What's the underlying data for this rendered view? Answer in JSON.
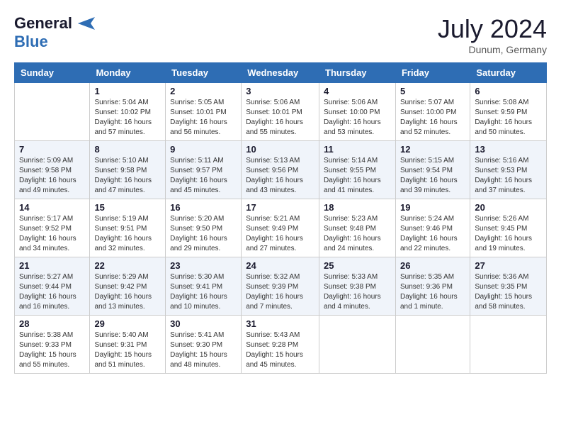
{
  "header": {
    "logo_general": "General",
    "logo_blue": "Blue",
    "month_year": "July 2024",
    "location": "Dunum, Germany"
  },
  "weekdays": [
    "Sunday",
    "Monday",
    "Tuesday",
    "Wednesday",
    "Thursday",
    "Friday",
    "Saturday"
  ],
  "weeks": [
    [
      {
        "day": "",
        "sunrise": "",
        "sunset": "",
        "daylight": ""
      },
      {
        "day": "1",
        "sunrise": "Sunrise: 5:04 AM",
        "sunset": "Sunset: 10:02 PM",
        "daylight": "Daylight: 16 hours and 57 minutes."
      },
      {
        "day": "2",
        "sunrise": "Sunrise: 5:05 AM",
        "sunset": "Sunset: 10:01 PM",
        "daylight": "Daylight: 16 hours and 56 minutes."
      },
      {
        "day": "3",
        "sunrise": "Sunrise: 5:06 AM",
        "sunset": "Sunset: 10:01 PM",
        "daylight": "Daylight: 16 hours and 55 minutes."
      },
      {
        "day": "4",
        "sunrise": "Sunrise: 5:06 AM",
        "sunset": "Sunset: 10:00 PM",
        "daylight": "Daylight: 16 hours and 53 minutes."
      },
      {
        "day": "5",
        "sunrise": "Sunrise: 5:07 AM",
        "sunset": "Sunset: 10:00 PM",
        "daylight": "Daylight: 16 hours and 52 minutes."
      },
      {
        "day": "6",
        "sunrise": "Sunrise: 5:08 AM",
        "sunset": "Sunset: 9:59 PM",
        "daylight": "Daylight: 16 hours and 50 minutes."
      }
    ],
    [
      {
        "day": "7",
        "sunrise": "Sunrise: 5:09 AM",
        "sunset": "Sunset: 9:58 PM",
        "daylight": "Daylight: 16 hours and 49 minutes."
      },
      {
        "day": "8",
        "sunrise": "Sunrise: 5:10 AM",
        "sunset": "Sunset: 9:58 PM",
        "daylight": "Daylight: 16 hours and 47 minutes."
      },
      {
        "day": "9",
        "sunrise": "Sunrise: 5:11 AM",
        "sunset": "Sunset: 9:57 PM",
        "daylight": "Daylight: 16 hours and 45 minutes."
      },
      {
        "day": "10",
        "sunrise": "Sunrise: 5:13 AM",
        "sunset": "Sunset: 9:56 PM",
        "daylight": "Daylight: 16 hours and 43 minutes."
      },
      {
        "day": "11",
        "sunrise": "Sunrise: 5:14 AM",
        "sunset": "Sunset: 9:55 PM",
        "daylight": "Daylight: 16 hours and 41 minutes."
      },
      {
        "day": "12",
        "sunrise": "Sunrise: 5:15 AM",
        "sunset": "Sunset: 9:54 PM",
        "daylight": "Daylight: 16 hours and 39 minutes."
      },
      {
        "day": "13",
        "sunrise": "Sunrise: 5:16 AM",
        "sunset": "Sunset: 9:53 PM",
        "daylight": "Daylight: 16 hours and 37 minutes."
      }
    ],
    [
      {
        "day": "14",
        "sunrise": "Sunrise: 5:17 AM",
        "sunset": "Sunset: 9:52 PM",
        "daylight": "Daylight: 16 hours and 34 minutes."
      },
      {
        "day": "15",
        "sunrise": "Sunrise: 5:19 AM",
        "sunset": "Sunset: 9:51 PM",
        "daylight": "Daylight: 16 hours and 32 minutes."
      },
      {
        "day": "16",
        "sunrise": "Sunrise: 5:20 AM",
        "sunset": "Sunset: 9:50 PM",
        "daylight": "Daylight: 16 hours and 29 minutes."
      },
      {
        "day": "17",
        "sunrise": "Sunrise: 5:21 AM",
        "sunset": "Sunset: 9:49 PM",
        "daylight": "Daylight: 16 hours and 27 minutes."
      },
      {
        "day": "18",
        "sunrise": "Sunrise: 5:23 AM",
        "sunset": "Sunset: 9:48 PM",
        "daylight": "Daylight: 16 hours and 24 minutes."
      },
      {
        "day": "19",
        "sunrise": "Sunrise: 5:24 AM",
        "sunset": "Sunset: 9:46 PM",
        "daylight": "Daylight: 16 hours and 22 minutes."
      },
      {
        "day": "20",
        "sunrise": "Sunrise: 5:26 AM",
        "sunset": "Sunset: 9:45 PM",
        "daylight": "Daylight: 16 hours and 19 minutes."
      }
    ],
    [
      {
        "day": "21",
        "sunrise": "Sunrise: 5:27 AM",
        "sunset": "Sunset: 9:44 PM",
        "daylight": "Daylight: 16 hours and 16 minutes."
      },
      {
        "day": "22",
        "sunrise": "Sunrise: 5:29 AM",
        "sunset": "Sunset: 9:42 PM",
        "daylight": "Daylight: 16 hours and 13 minutes."
      },
      {
        "day": "23",
        "sunrise": "Sunrise: 5:30 AM",
        "sunset": "Sunset: 9:41 PM",
        "daylight": "Daylight: 16 hours and 10 minutes."
      },
      {
        "day": "24",
        "sunrise": "Sunrise: 5:32 AM",
        "sunset": "Sunset: 9:39 PM",
        "daylight": "Daylight: 16 hours and 7 minutes."
      },
      {
        "day": "25",
        "sunrise": "Sunrise: 5:33 AM",
        "sunset": "Sunset: 9:38 PM",
        "daylight": "Daylight: 16 hours and 4 minutes."
      },
      {
        "day": "26",
        "sunrise": "Sunrise: 5:35 AM",
        "sunset": "Sunset: 9:36 PM",
        "daylight": "Daylight: 16 hours and 1 minute."
      },
      {
        "day": "27",
        "sunrise": "Sunrise: 5:36 AM",
        "sunset": "Sunset: 9:35 PM",
        "daylight": "Daylight: 15 hours and 58 minutes."
      }
    ],
    [
      {
        "day": "28",
        "sunrise": "Sunrise: 5:38 AM",
        "sunset": "Sunset: 9:33 PM",
        "daylight": "Daylight: 15 hours and 55 minutes."
      },
      {
        "day": "29",
        "sunrise": "Sunrise: 5:40 AM",
        "sunset": "Sunset: 9:31 PM",
        "daylight": "Daylight: 15 hours and 51 minutes."
      },
      {
        "day": "30",
        "sunrise": "Sunrise: 5:41 AM",
        "sunset": "Sunset: 9:30 PM",
        "daylight": "Daylight: 15 hours and 48 minutes."
      },
      {
        "day": "31",
        "sunrise": "Sunrise: 5:43 AM",
        "sunset": "Sunset: 9:28 PM",
        "daylight": "Daylight: 15 hours and 45 minutes."
      },
      {
        "day": "",
        "sunrise": "",
        "sunset": "",
        "daylight": ""
      },
      {
        "day": "",
        "sunrise": "",
        "sunset": "",
        "daylight": ""
      },
      {
        "day": "",
        "sunrise": "",
        "sunset": "",
        "daylight": ""
      }
    ]
  ]
}
